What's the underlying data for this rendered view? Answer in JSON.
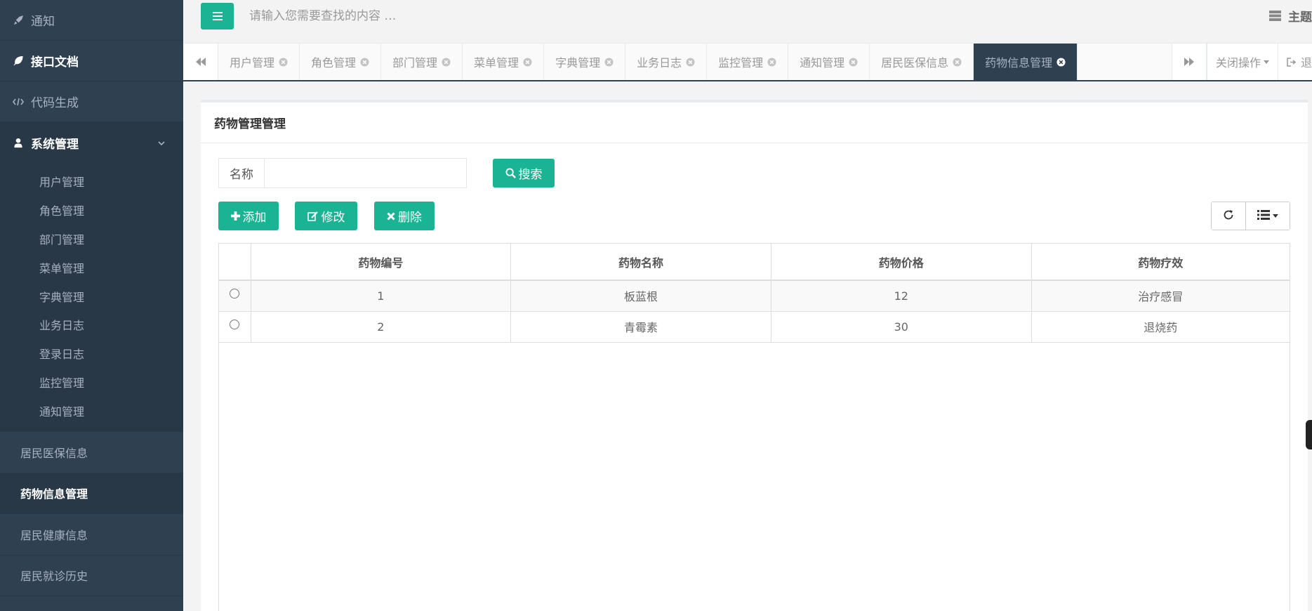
{
  "sidebar": {
    "top_items": [
      {
        "label": "通知",
        "icon": "rocket-icon"
      },
      {
        "label": "接口文档",
        "icon": "leaf-icon"
      },
      {
        "label": "代码生成",
        "icon": "code-icon"
      }
    ],
    "system": {
      "label": "系统管理",
      "icon": "user-icon"
    },
    "sub_items": [
      "用户管理",
      "角色管理",
      "部门管理",
      "菜单管理",
      "字典管理",
      "业务日志",
      "登录日志",
      "监控管理",
      "通知管理"
    ],
    "bottom_items": [
      "居民医保信息",
      "药物信息管理",
      "居民健康信息",
      "居民就诊历史"
    ]
  },
  "topbar": {
    "search_placeholder": "请输入您需要查找的内容 …",
    "theme_label": "主题"
  },
  "tabs": [
    "用户管理",
    "角色管理",
    "部门管理",
    "菜单管理",
    "字典管理",
    "业务日志",
    "监控管理",
    "通知管理",
    "居民医保信息",
    "药物信息管理"
  ],
  "tabs_right": {
    "close_ops": "关闭操作",
    "logout": "退"
  },
  "panel": {
    "title": "药物管理管理",
    "filter_label": "名称",
    "search_btn": "搜索",
    "add_btn": "添加",
    "edit_btn": "修改",
    "delete_btn": "删除"
  },
  "table": {
    "columns": [
      "药物编号",
      "药物名称",
      "药物价格",
      "药物疗效"
    ],
    "rows": [
      [
        "1",
        "板蓝根",
        "12",
        "治疗感冒"
      ],
      [
        "2",
        "青霉素",
        "30",
        "退烧药"
      ]
    ]
  },
  "colors": {
    "primary": "#1ab394",
    "sidebar": "#2f4050",
    "sidebar_dark": "#293846"
  }
}
